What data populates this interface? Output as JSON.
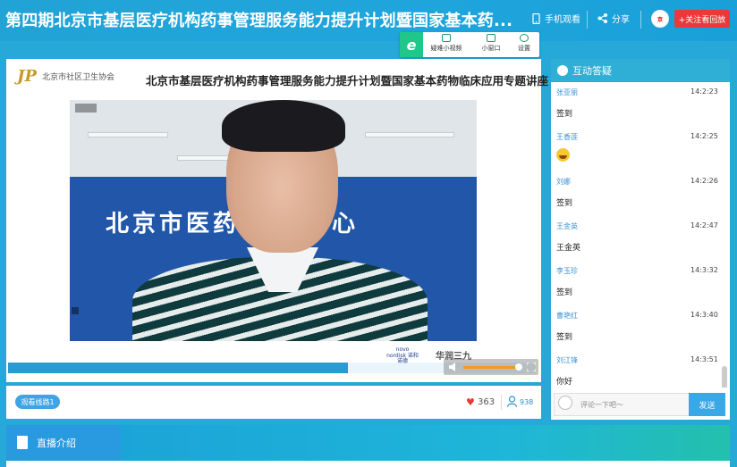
{
  "header": {
    "title": "第四期北京市基层医疗机构药事管理服务能力提升计划暨国家基本药...",
    "mobile_label": "手机观看",
    "share_label": "分享",
    "follow_label": "+关注看回放"
  },
  "toolbar": {
    "e_label": "e",
    "video_label": "疑难小视频",
    "window_label": "小窗口",
    "settings_label": "设置"
  },
  "slide": {
    "assoc_logo": "JP",
    "assoc_name": "北京市社区卫生协会",
    "title": "北京市基层医疗机构药事管理服务能力提升计划暨国家基本药物临床应用专题讲座"
  },
  "video": {
    "banner_text": "北京市医药     服务中心",
    "sponsor1": "novo nordisk 诺和诺德",
    "sponsor2": "华润三九"
  },
  "info": {
    "route_label": "观看线路1",
    "likes": "363",
    "views": "938"
  },
  "intro": {
    "tab_label": "直播介绍"
  },
  "chat": {
    "title": "互动答疑",
    "messages": [
      {
        "name": "张亚丽",
        "time": "14:2:23",
        "text": "签到"
      },
      {
        "name": "王香莲",
        "time": "14:2:25",
        "text": ""
      },
      {
        "name": "刘娜",
        "time": "14:2:26",
        "text": "签到"
      },
      {
        "name": "王金英",
        "time": "14:2:47",
        "text": "王金英"
      },
      {
        "name": "李玉珍",
        "time": "14:3:32",
        "text": "签到"
      },
      {
        "name": "曹艳红",
        "time": "14:3:40",
        "text": "签到"
      },
      {
        "name": "刘江锋",
        "time": "14:3:51",
        "text": "你好"
      }
    ],
    "input_placeholder": "评论一下吧～",
    "send_label": "发送"
  }
}
